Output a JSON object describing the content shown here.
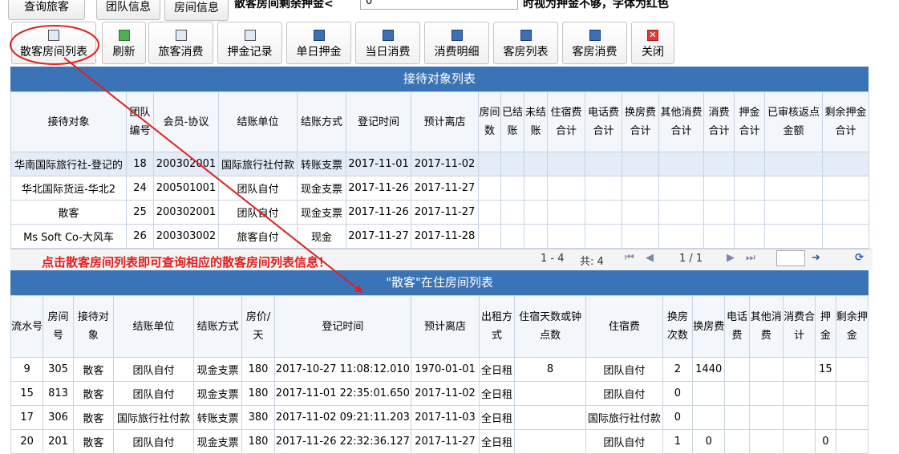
{
  "top": {
    "tabs": [
      "查询旅客",
      "团队信息",
      "房间信息"
    ],
    "deposit_label": "散客房间剩余押金<",
    "deposit_value": "0",
    "deposit_note": "时视为押金不够，字体为红色"
  },
  "toolbar": {
    "buttons": [
      "散客房间列表",
      "刷新",
      "旅客消费",
      "押金记录",
      "单日押金",
      "当日消费",
      "消费明细",
      "客房列表",
      "客房消费",
      "关闭"
    ]
  },
  "reception": {
    "title": "接待对象列表",
    "headers": [
      "接待对象",
      "团队编号",
      "会员-协议",
      "结账单位",
      "结账方式",
      "登记时间",
      "预计离店",
      "房间数",
      "已结账",
      "未结账",
      "住宿费合计",
      "电话费合计",
      "换房费合计",
      "其他消费合计",
      "消费合计",
      "押金合计",
      "已审核返点金额",
      "剩余押金合计"
    ],
    "rows": [
      [
        "华南国际旅行社-登记的",
        "18",
        "200302001",
        "国际旅行社付款",
        "转账支票",
        "2017-11-01",
        "2017-11-02",
        "",
        "",
        "",
        "",
        "",
        "",
        "",
        "",
        "",
        "",
        ""
      ],
      [
        "华北国际货运-华北2",
        "24",
        "200501001",
        "团队自付",
        "现金支票",
        "2017-11-26",
        "2017-11-27",
        "",
        "",
        "",
        "",
        "",
        "",
        "",
        "",
        "",
        "",
        ""
      ],
      [
        "散客",
        "25",
        "200302001",
        "团队自付",
        "现金支票",
        "2017-11-26",
        "2017-11-27",
        "",
        "",
        "",
        "",
        "",
        "",
        "",
        "",
        "",
        "",
        ""
      ],
      [
        "Ms Soft Co-大风车",
        "26",
        "200303002",
        "旅客自付",
        "现金",
        "2017-11-27",
        "2017-11-28",
        "",
        "",
        "",
        "",
        "",
        "",
        "",
        "",
        "",
        "",
        ""
      ]
    ],
    "selected_row": 0,
    "pager": {
      "range": "1 - 4",
      "total": "共: 4",
      "page": "1 / 1"
    }
  },
  "hint": "点击散客房间列表即可查询相应的散客房间列表信息！",
  "rooms": {
    "title": "\"散客\"在住房间列表",
    "headers": [
      "流水号",
      "房间号",
      "接待对象",
      "结账单位",
      "结账方式",
      "房价/天",
      "登记时间",
      "预计离店",
      "出租方式",
      "住宿天数或钟点数",
      "住宿费",
      "换房次数",
      "换房费",
      "电话费",
      "其他消费",
      "消费合计",
      "押金",
      "剩余押金"
    ],
    "rows": [
      [
        "9",
        "305",
        "散客",
        "团队自付",
        "现金支票",
        "180",
        "2017-10-27 11:08:12.010",
        "1970-01-01",
        "全日租",
        "8",
        "团队自付",
        "2",
        "1440",
        "",
        "",
        "",
        "15",
        ""
      ],
      [
        "15",
        "813",
        "散客",
        "团队自付",
        "现金支票",
        "180",
        "2017-11-01 22:35:01.650",
        "2017-11-02",
        "全日租",
        "",
        "团队自付",
        "0",
        "",
        "",
        "",
        "",
        "",
        ""
      ],
      [
        "17",
        "306",
        "散客",
        "国际旅行社付款",
        "转账支票",
        "380",
        "2017-11-02 09:21:11.203",
        "2017-11-03",
        "全日租",
        "",
        "国际旅行社付款",
        "0",
        "",
        "",
        "",
        "",
        "",
        ""
      ],
      [
        "20",
        "201",
        "散客",
        "团队自付",
        "现金支票",
        "180",
        "2017-11-26 22:32:36.127",
        "2017-11-27",
        "全日租",
        "",
        "团队自付",
        "1",
        "0",
        "",
        "",
        "",
        "0",
        ""
      ]
    ]
  },
  "colors": {
    "header_blue": "#3a74b7",
    "hint_red": "#e02020",
    "annotation_red": "#e02020"
  }
}
